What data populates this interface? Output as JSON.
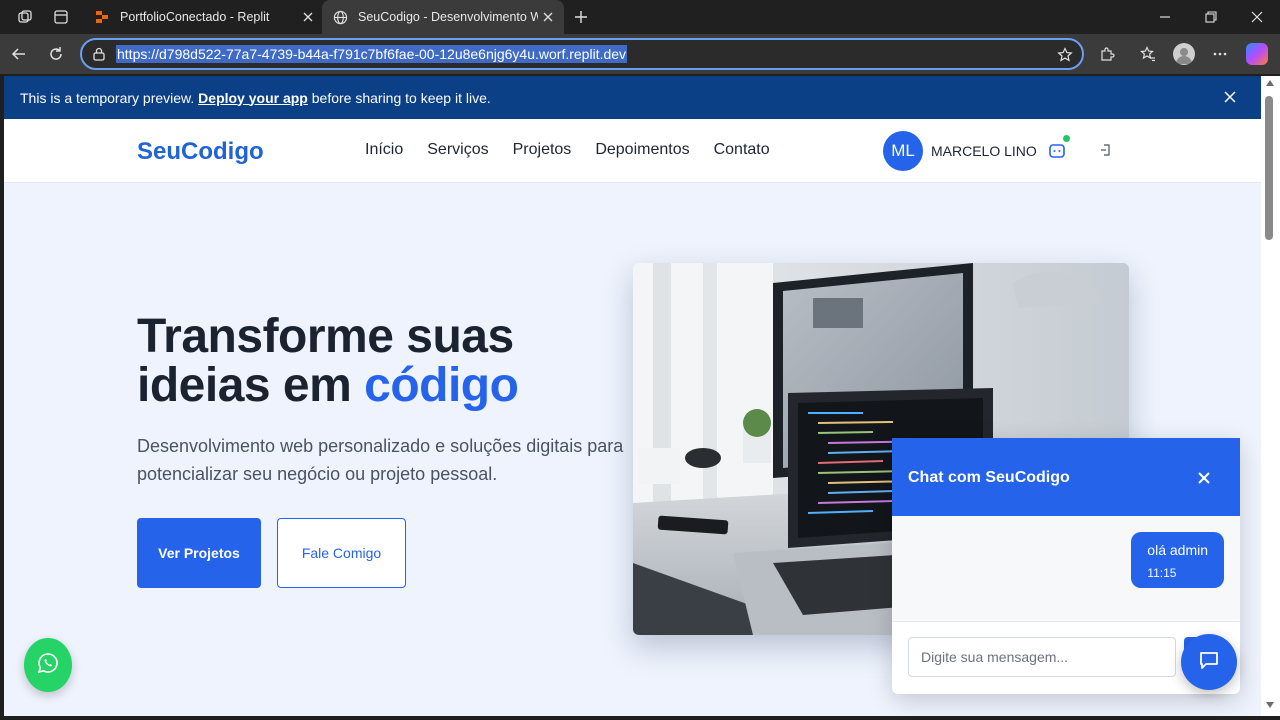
{
  "browser": {
    "tabs": [
      {
        "title": "PortfolioConectado - Replit",
        "active": false
      },
      {
        "title": "SeuCodigo - Desenvolvimento Web",
        "active": true
      }
    ],
    "url": "https://d798d522-77a7-4739-b44a-f791c7bf6fae-00-12u8e6njg6y4u.worf.replit.dev"
  },
  "banner": {
    "text_before": "This is a temporary preview. ",
    "link": "Deploy your app",
    "text_after": " before sharing to keep it live."
  },
  "header": {
    "logo": "SeuCodigo",
    "nav": [
      "Início",
      "Serviços",
      "Projetos",
      "Depoimentos",
      "Contato"
    ],
    "avatar_initials": "ML",
    "user_name": "MARCELO LINO"
  },
  "hero": {
    "title_line1": "Transforme suas",
    "title_line2_plain": "ideias em ",
    "title_line2_accent": "código",
    "subtitle": "Desenvolvimento web personalizado e soluções digitais para potencializar seu negócio ou projeto pessoal.",
    "primary_button": "Ver Projetos",
    "secondary_button": "Fale Comigo"
  },
  "chat": {
    "title": "Chat com SeuCodigo",
    "messages": [
      {
        "text": "olá admin",
        "time": "11:15"
      }
    ],
    "input_placeholder": "Digite sua mensagem..."
  },
  "colors": {
    "brand": "#2563eb",
    "banner": "#0b3f86",
    "whatsapp": "#25d366",
    "online": "#22c55e"
  },
  "icons": [
    "workspaces-icon",
    "tab-actions-icon",
    "replit-favicon",
    "globe-icon",
    "close-icon",
    "plus-icon",
    "minimize-icon",
    "restore-icon",
    "back-icon",
    "refresh-icon",
    "lock-icon",
    "star-icon",
    "extensions-icon",
    "favorites-icon",
    "profile-icon",
    "more-icon",
    "copilot-icon",
    "chat-icon",
    "logout-icon",
    "whatsapp-icon",
    "message-icon"
  ]
}
